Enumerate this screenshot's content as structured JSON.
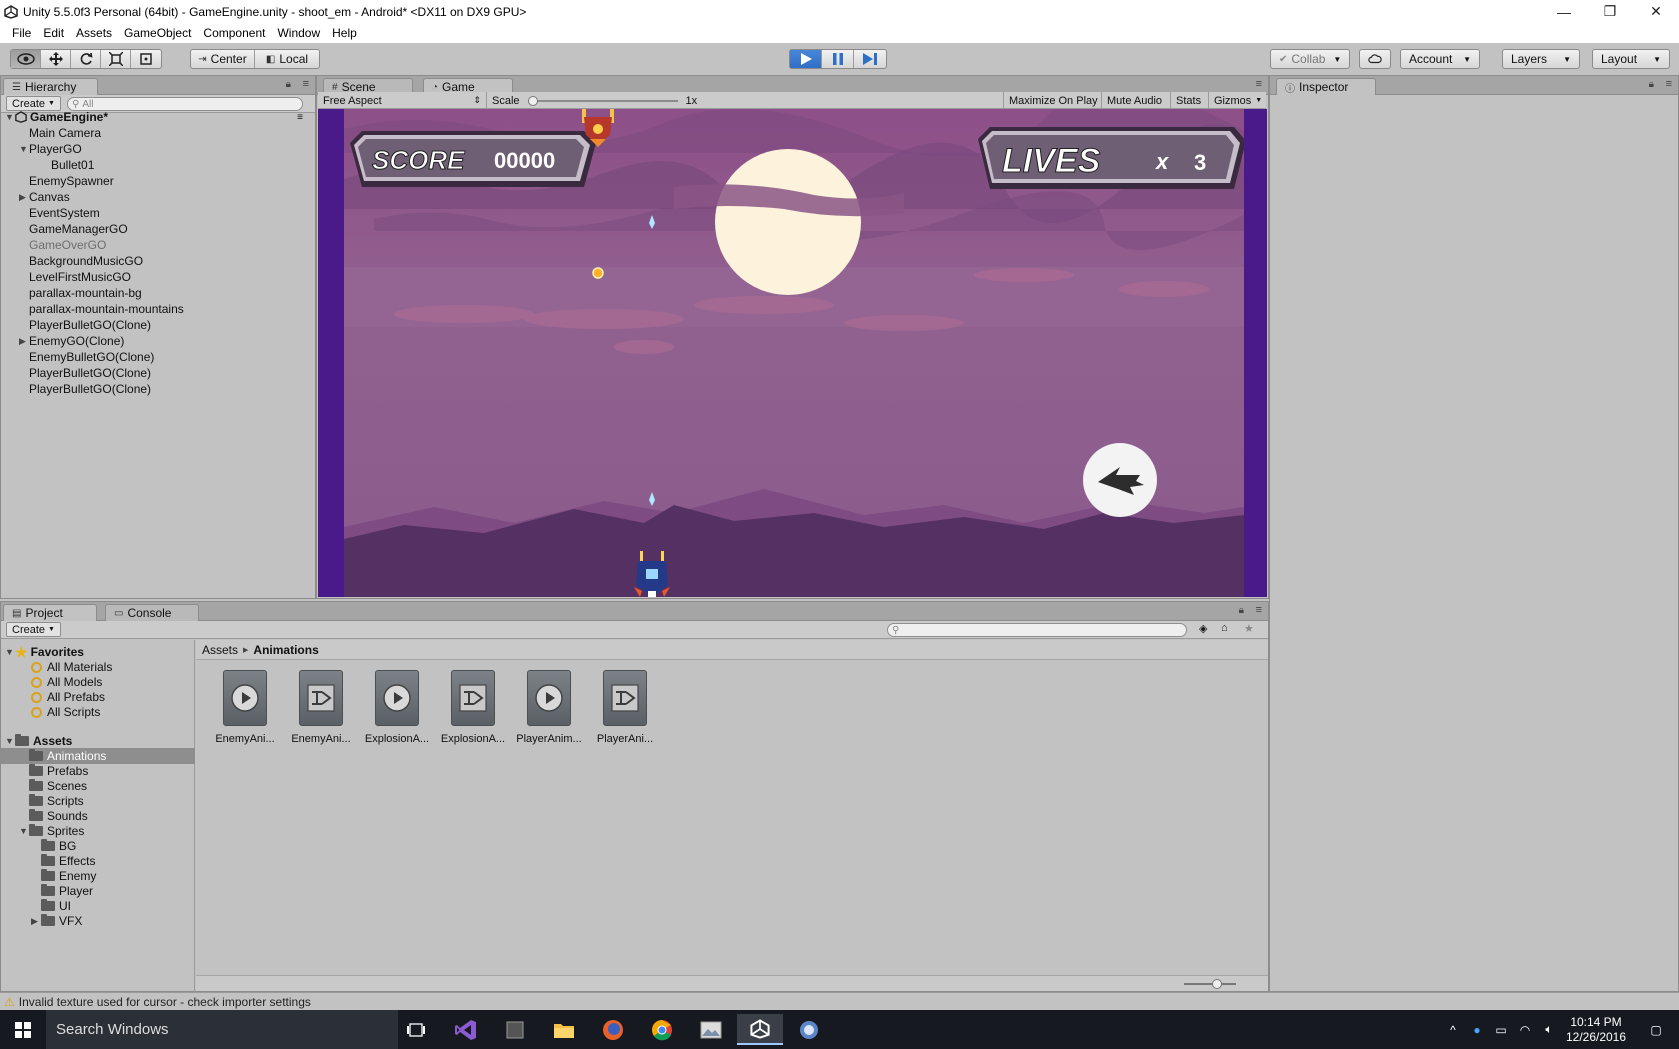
{
  "window": {
    "title": "Unity 5.5.0f3 Personal (64bit) - GameEngine.unity - shoot_em - Android* <DX11 on DX9 GPU>",
    "controls": [
      "—",
      "❐",
      "✕"
    ]
  },
  "menu": [
    "File",
    "Edit",
    "Assets",
    "GameObject",
    "Component",
    "Window",
    "Help"
  ],
  "toolbar": {
    "pivot_center": "Center",
    "pivot_local": "Local",
    "collab": "Collab",
    "account": "Account",
    "layers": "Layers",
    "layout": "Layout"
  },
  "hierarchy": {
    "tab": "Hierarchy",
    "create": "Create",
    "search_placeholder": "All",
    "scene_name": "GameEngine*",
    "items": [
      {
        "label": "Main Camera",
        "depth": 1,
        "expander": "",
        "dim": false
      },
      {
        "label": "PlayerGO",
        "depth": 1,
        "expander": "▼",
        "dim": false
      },
      {
        "label": "Bullet01",
        "depth": 2,
        "expander": "",
        "dim": false
      },
      {
        "label": "EnemySpawner",
        "depth": 1,
        "expander": "",
        "dim": false
      },
      {
        "label": "Canvas",
        "depth": 1,
        "expander": "▶",
        "dim": false
      },
      {
        "label": "EventSystem",
        "depth": 1,
        "expander": "",
        "dim": false
      },
      {
        "label": "GameManagerGO",
        "depth": 1,
        "expander": "",
        "dim": false
      },
      {
        "label": "GameOverGO",
        "depth": 1,
        "expander": "",
        "dim": true
      },
      {
        "label": "BackgroundMusicGO",
        "depth": 1,
        "expander": "",
        "dim": false
      },
      {
        "label": "LevelFirstMusicGO",
        "depth": 1,
        "expander": "",
        "dim": false
      },
      {
        "label": "parallax-mountain-bg",
        "depth": 1,
        "expander": "",
        "dim": false
      },
      {
        "label": "parallax-mountain-mountains",
        "depth": 1,
        "expander": "",
        "dim": false
      },
      {
        "label": "PlayerBulletGO(Clone)",
        "depth": 1,
        "expander": "",
        "dim": false
      },
      {
        "label": "EnemyGO(Clone)",
        "depth": 1,
        "expander": "▶",
        "dim": false
      },
      {
        "label": "EnemyBulletGO(Clone)",
        "depth": 1,
        "expander": "",
        "dim": false
      },
      {
        "label": "PlayerBulletGO(Clone)",
        "depth": 1,
        "expander": "",
        "dim": false
      },
      {
        "label": "PlayerBulletGO(Clone)",
        "depth": 1,
        "expander": "",
        "dim": false
      }
    ]
  },
  "scene_tabs": {
    "scene": "Scene",
    "game": "Game"
  },
  "game_view": {
    "aspect": "Free Aspect",
    "scale_label": "Scale",
    "scale_value": "1x",
    "maximize": "Maximize On Play",
    "mute": "Mute Audio",
    "stats": "Stats",
    "gizmos": "Gizmos",
    "score_label": "SCORE",
    "score_value": "00000",
    "lives_label": "LIVES",
    "lives_x": "x",
    "lives_value": "3"
  },
  "inspector": {
    "tab": "Inspector"
  },
  "project": {
    "tab_project": "Project",
    "tab_console": "Console",
    "create": "Create",
    "favorites_label": "Favorites",
    "favorites": [
      "All Materials",
      "All Models",
      "All Prefabs",
      "All Scripts"
    ],
    "assets_label": "Assets",
    "folders": [
      {
        "label": "Animations",
        "depth": 1,
        "selected": true,
        "expander": ""
      },
      {
        "label": "Prefabs",
        "depth": 1,
        "selected": false,
        "expander": ""
      },
      {
        "label": "Scenes",
        "depth": 1,
        "selected": false,
        "expander": ""
      },
      {
        "label": "Scripts",
        "depth": 1,
        "selected": false,
        "expander": ""
      },
      {
        "label": "Sounds",
        "depth": 1,
        "selected": false,
        "expander": ""
      },
      {
        "label": "Sprites",
        "depth": 1,
        "selected": false,
        "expander": "▼"
      },
      {
        "label": "BG",
        "depth": 2,
        "selected": false,
        "expander": ""
      },
      {
        "label": "Effects",
        "depth": 2,
        "selected": false,
        "expander": ""
      },
      {
        "label": "Enemy",
        "depth": 2,
        "selected": false,
        "expander": ""
      },
      {
        "label": "Player",
        "depth": 2,
        "selected": false,
        "expander": ""
      },
      {
        "label": "UI",
        "depth": 2,
        "selected": false,
        "expander": ""
      },
      {
        "label": "VFX",
        "depth": 2,
        "selected": false,
        "expander": "▶"
      }
    ],
    "breadcrumb_root": "Assets",
    "breadcrumb_sep": "▶",
    "breadcrumb_current": "Animations",
    "assets": [
      {
        "label": "EnemyAni...",
        "kind": "clip"
      },
      {
        "label": "EnemyAni...",
        "kind": "controller"
      },
      {
        "label": "ExplosionA...",
        "kind": "clip"
      },
      {
        "label": "ExplosionA...",
        "kind": "controller"
      },
      {
        "label": "PlayerAnim...",
        "kind": "clip"
      },
      {
        "label": "PlayerAni...",
        "kind": "controller"
      }
    ]
  },
  "status": {
    "message": "Invalid texture used for cursor - check importer settings"
  },
  "taskbar": {
    "search": "Search Windows",
    "time": "10:14 PM",
    "date": "12/26/2016"
  },
  "colors": {
    "play_blue": "#3b7bd1",
    "sky_top": "#8a4f86",
    "sky_mid": "#8a5a8c",
    "mountain": "#5e3468",
    "game_border": "#4a1a8a",
    "taskbar": "#161a20"
  }
}
